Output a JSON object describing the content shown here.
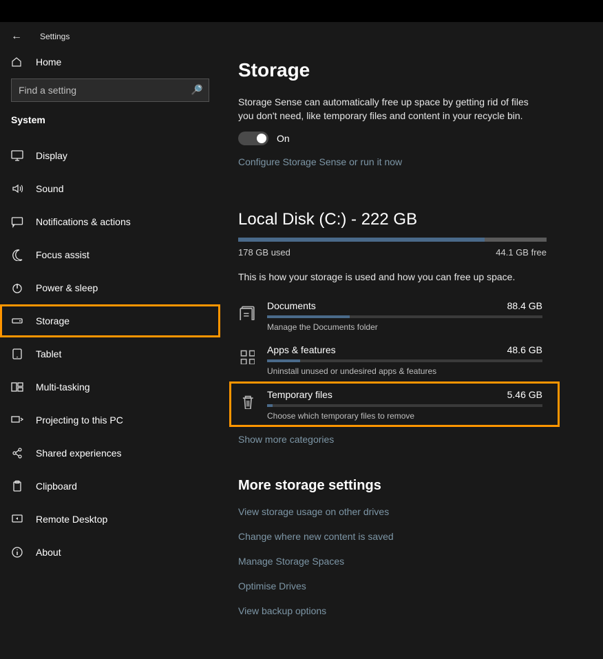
{
  "app_title": "Settings",
  "sidebar": {
    "home_label": "Home",
    "search_placeholder": "Find a setting",
    "section_label": "System",
    "items": [
      {
        "key": "display",
        "label": "Display",
        "icon": "monitor"
      },
      {
        "key": "sound",
        "label": "Sound",
        "icon": "speaker"
      },
      {
        "key": "notifications",
        "label": "Notifications & actions",
        "icon": "message"
      },
      {
        "key": "focus",
        "label": "Focus assist",
        "icon": "moon"
      },
      {
        "key": "power",
        "label": "Power & sleep",
        "icon": "power"
      },
      {
        "key": "storage",
        "label": "Storage",
        "icon": "drive",
        "highlight": true
      },
      {
        "key": "tablet",
        "label": "Tablet",
        "icon": "tablet"
      },
      {
        "key": "multitask",
        "label": "Multi-tasking",
        "icon": "multitask"
      },
      {
        "key": "projecting",
        "label": "Projecting to this PC",
        "icon": "project"
      },
      {
        "key": "shared",
        "label": "Shared experiences",
        "icon": "share"
      },
      {
        "key": "clipboard",
        "label": "Clipboard",
        "icon": "clipboard"
      },
      {
        "key": "remote",
        "label": "Remote Desktop",
        "icon": "remote"
      },
      {
        "key": "about",
        "label": "About",
        "icon": "info"
      }
    ]
  },
  "main": {
    "title": "Storage",
    "description": "Storage Sense can automatically free up space by getting rid of files you don't need, like temporary files and content in your recycle bin.",
    "toggle_state": "On",
    "configure_link": "Configure Storage Sense or run it now",
    "disk": {
      "heading": "Local Disk (C:) - 222 GB",
      "used_label": "178 GB used",
      "free_label": "44.1 GB free",
      "used_pct": 80
    },
    "usage_hint": "This is how your storage is used and how you can free up space.",
    "categories": [
      {
        "name": "Documents",
        "size": "88.4 GB",
        "sub": "Manage the Documents folder",
        "fill": 30,
        "icon": "doc"
      },
      {
        "name": "Apps & features",
        "size": "48.6 GB",
        "sub": "Uninstall unused or undesired apps & features",
        "fill": 12,
        "icon": "apps"
      },
      {
        "name": "Temporary files",
        "size": "5.46 GB",
        "sub": "Choose which temporary files to remove",
        "fill": 2,
        "icon": "trash",
        "highlight": true
      }
    ],
    "show_more": "Show more categories",
    "more_heading": "More storage settings",
    "more_links": [
      "View storage usage on other drives",
      "Change where new content is saved",
      "Manage Storage Spaces",
      "Optimise Drives",
      "View backup options"
    ]
  }
}
